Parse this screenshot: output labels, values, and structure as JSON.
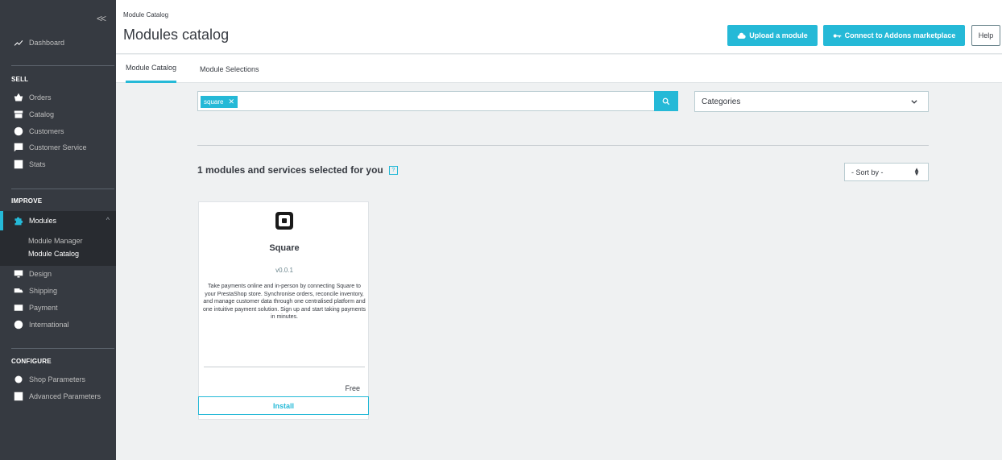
{
  "sidebar": {
    "collapse_label": "<<",
    "dashboard": "Dashboard",
    "sections": {
      "sell": "SELL",
      "improve": "IMPROVE",
      "configure": "CONFIGURE"
    },
    "sell_items": [
      "Orders",
      "Catalog",
      "Customers",
      "Customer Service",
      "Stats"
    ],
    "modules": {
      "label": "Modules",
      "subitems": [
        "Module Manager",
        "Module Catalog"
      ],
      "active_subitem": "Module Catalog"
    },
    "improve_items": [
      "Design",
      "Shipping",
      "Payment",
      "International"
    ],
    "configure_items": [
      "Shop Parameters",
      "Advanced Parameters"
    ]
  },
  "header": {
    "breadcrumb": "Module Catalog",
    "title": "Modules catalog",
    "upload_button": "Upload a module",
    "connect_button": "Connect to Addons marketplace",
    "help_button": "Help"
  },
  "tabs": [
    {
      "label": "Module Catalog",
      "active": true
    },
    {
      "label": "Module Selections",
      "active": false
    }
  ],
  "search": {
    "tag": "square",
    "categories_placeholder": "Categories"
  },
  "results": {
    "title": "1 modules and services selected for you",
    "help_mark": "?",
    "sort_label": "- Sort by -"
  },
  "module_card": {
    "name": "Square",
    "version": "v0.0.1",
    "description": "Take payments online and in-person by connecting Square to your PrestaShop store. Synchronise orders, reconcile inventory, and manage customer data through one centralised platform and one intuitive payment solution. Sign up and start taking payments in minutes.",
    "price": "Free",
    "install_button": "Install"
  },
  "colors": {
    "accent": "#25b9d7",
    "sidebar_bg": "#363a41",
    "content_bg": "#eff1f2"
  }
}
